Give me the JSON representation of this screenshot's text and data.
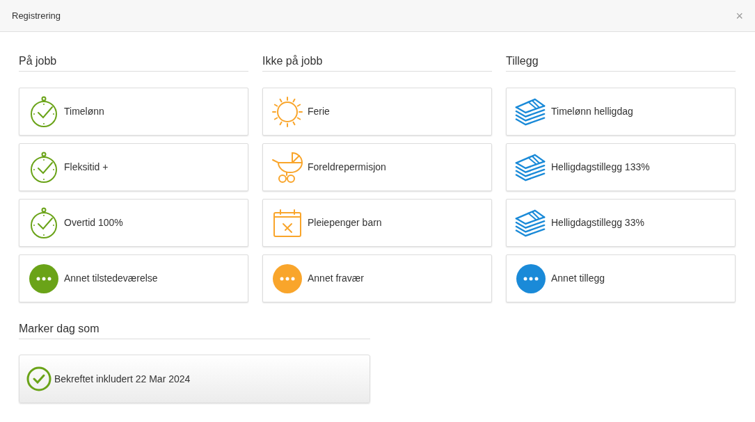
{
  "window": {
    "title": "Registrering",
    "close": "×"
  },
  "sections": [
    {
      "title": "På jobb",
      "color": "#6aa318",
      "items": [
        {
          "label": "Timelønn",
          "kind": "stopwatch"
        },
        {
          "label": "Fleksitid +",
          "kind": "stopwatch"
        },
        {
          "label": "Overtid 100%",
          "kind": "stopwatch"
        },
        {
          "label": "Annet tilstedeværelse",
          "kind": "more"
        }
      ]
    },
    {
      "title": "Ikke på jobb",
      "color": "#f9a52b",
      "items": [
        {
          "label": "Ferie",
          "kind": "sun"
        },
        {
          "label": "Foreldrepermisjon",
          "kind": "stroller"
        },
        {
          "label": "Pleiepenger barn",
          "kind": "calendar"
        },
        {
          "label": "Annet fravær",
          "kind": "more"
        }
      ]
    },
    {
      "title": "Tillegg",
      "color": "#1a8ad8",
      "items": [
        {
          "label": "Timelønn helligdag",
          "kind": "money"
        },
        {
          "label": "Helligdagstillegg 133%",
          "kind": "money"
        },
        {
          "label": "Helligdagstillegg 33%",
          "kind": "money"
        },
        {
          "label": "Annet tillegg",
          "kind": "more"
        }
      ]
    }
  ],
  "mark_day": {
    "title": "Marker dag som",
    "button": {
      "label": "Bekreftet inkludert 22 Mar 2024",
      "checked": true
    }
  }
}
